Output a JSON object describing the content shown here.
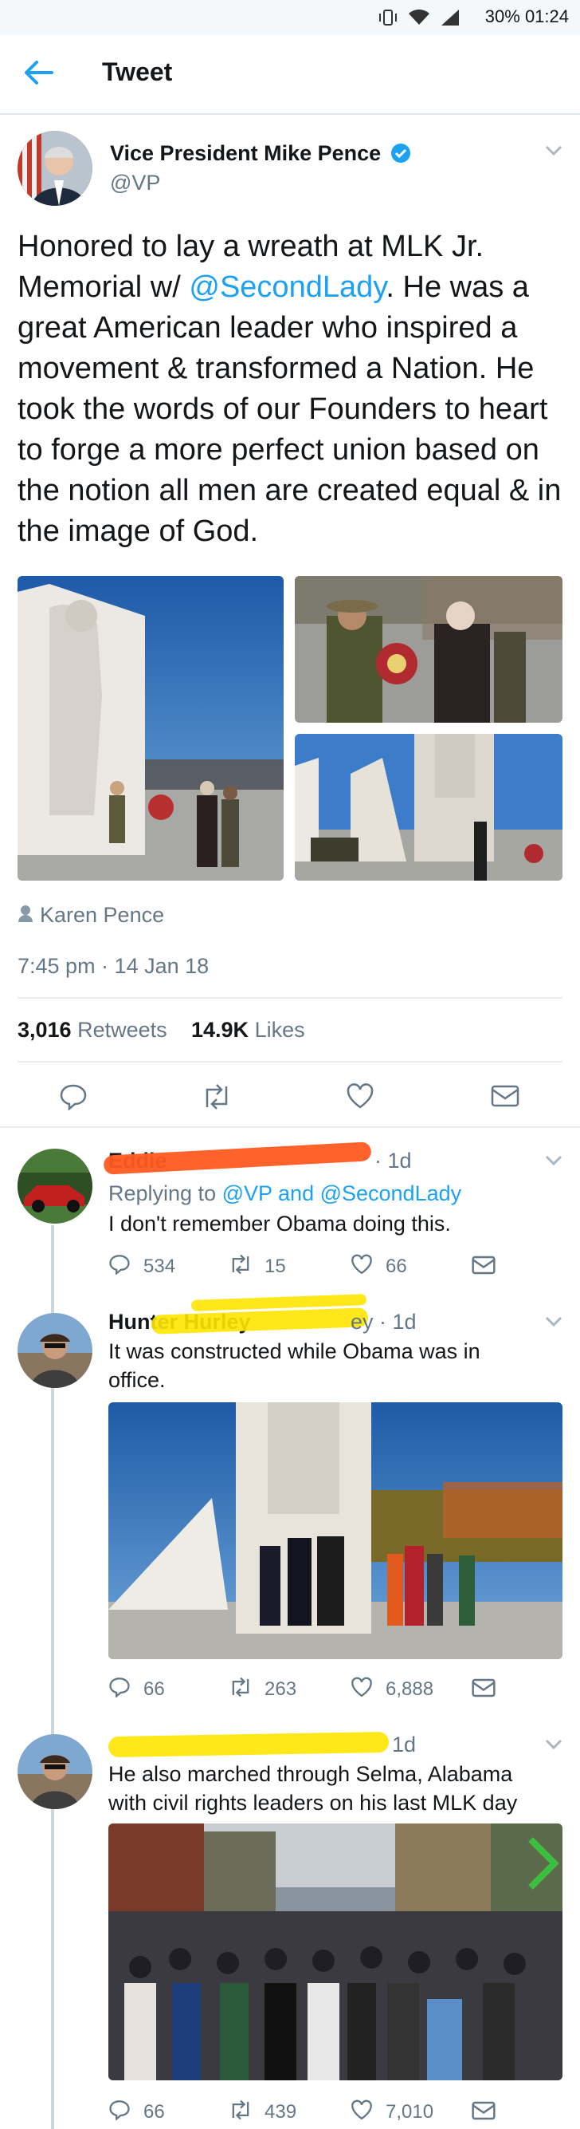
{
  "status": {
    "battery": "30%",
    "time": "01:24"
  },
  "header": {
    "title": "Tweet"
  },
  "tweet": {
    "name": "Vice President Mike Pence",
    "handle": "@VP",
    "text_parts": [
      "Honored to lay a wreath at MLK Jr. Memorial w/ ",
      "@SecondLady",
      ". He was a great American leader who inspired a movement & transformed a Nation. He took the words of our Founders to heart to forge a more perfect union based on the notion all men are created equal & in the image of God."
    ],
    "tagged": "Karen Pence",
    "timestamp": "7:45 pm · 14 Jan 18",
    "retweets": "3,016",
    "retweets_label": "Retweets",
    "likes": "14.9K",
    "likes_label": "Likes"
  },
  "replies": [
    {
      "name": "Eddie",
      "time": "· 1d",
      "replying_prefix": "Replying to ",
      "replying_to": "@VP and @SecondLady",
      "text": "I don't remember Obama doing this.",
      "reply_count": "534",
      "retweet_count": "15",
      "like_count": "66"
    },
    {
      "name": "Hunter Hurley",
      "time": "ey · 1d",
      "text": "It was constructed while Obama was in office.",
      "reply_count": "66",
      "retweet_count": "263",
      "like_count": "6,888"
    },
    {
      "name": "",
      "time": "1d",
      "text": "He also marched through Selma, Alabama with civil rights leaders on his last MLK day",
      "reply_count": "66",
      "retweet_count": "439",
      "like_count": "7,010"
    }
  ],
  "colors": {
    "accent": "#1da1f2",
    "muted": "#657786",
    "divider": "#e6ecf0"
  }
}
